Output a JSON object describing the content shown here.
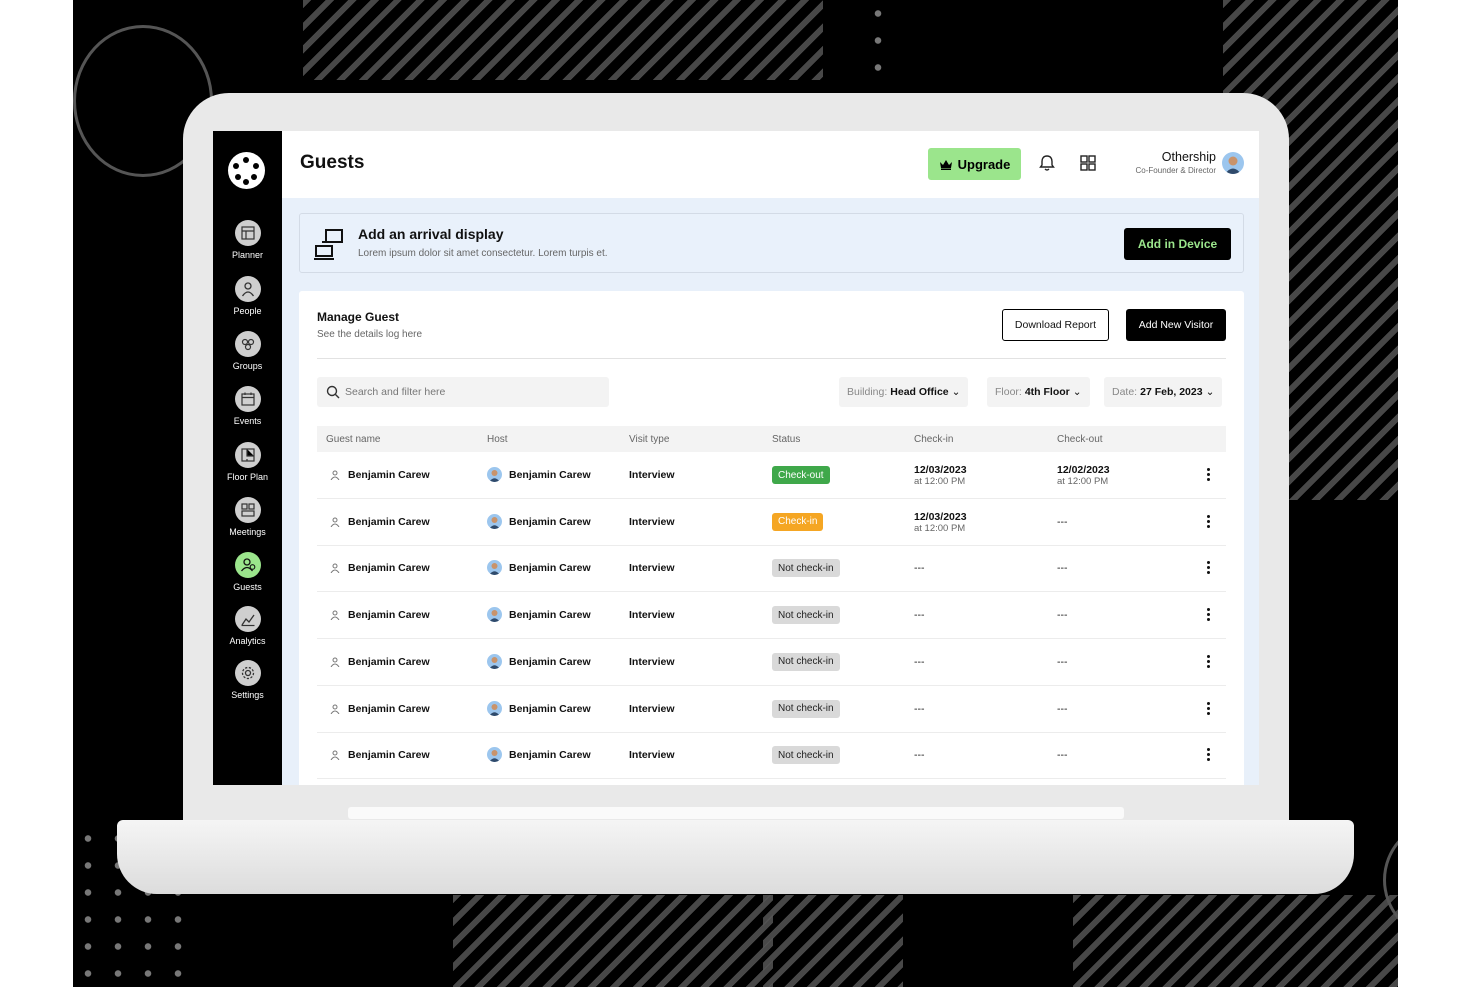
{
  "sidebar": {
    "items": [
      {
        "label": "Planner",
        "icon": "planner-icon"
      },
      {
        "label": "People",
        "icon": "person-icon"
      },
      {
        "label": "Groups",
        "icon": "groups-icon"
      },
      {
        "label": "Events",
        "icon": "calendar-icon"
      },
      {
        "label": "Floor Plan",
        "icon": "floor-plan-icon"
      },
      {
        "label": "Meetings",
        "icon": "meetings-icon"
      },
      {
        "label": "Guests",
        "icon": "guests-icon",
        "active": true
      },
      {
        "label": "Analytics",
        "icon": "analytics-icon"
      },
      {
        "label": "Settings",
        "icon": "gear-icon"
      }
    ]
  },
  "header": {
    "title": "Guests",
    "upgrade_label": "Upgrade",
    "user_name": "Othership",
    "user_role": "Co-Founder & Director"
  },
  "banner": {
    "title": "Add an arrival display",
    "subtitle": "Lorem ipsum dolor sit amet consectetur. Lorem turpis et.",
    "button": "Add in Device"
  },
  "manage": {
    "title": "Manage Guest",
    "subtitle": "See the details log here",
    "download_label": "Download Report",
    "add_label": "Add New Visitor"
  },
  "search": {
    "placeholder": "Search and filter here"
  },
  "filters": {
    "building": {
      "label": "Building:",
      "value": "Head Office"
    },
    "floor": {
      "label": "Floor:",
      "value": "4th Floor"
    },
    "date": {
      "label": "Date:",
      "value": "27 Feb, 2023"
    }
  },
  "table": {
    "columns": [
      "Guest name",
      "Host",
      "Visit type",
      "Status",
      "Check-in",
      "Check-out"
    ],
    "rows": [
      {
        "guest": "Benjamin Carew",
        "host": "Benjamin Carew",
        "type": "Interview",
        "status": "Check-out",
        "checkin_date": "12/03/2023",
        "checkin_time": "at 12:00 PM",
        "checkout_date": "12/02/2023",
        "checkout_time": "at 12:00 PM"
      },
      {
        "guest": "Benjamin Carew",
        "host": "Benjamin Carew",
        "type": "Interview",
        "status": "Check-in",
        "checkin_date": "12/03/2023",
        "checkin_time": "at 12:00 PM",
        "checkout": "---"
      },
      {
        "guest": "Benjamin Carew",
        "host": "Benjamin Carew",
        "type": "Interview",
        "status": "Not check-in",
        "checkin": "---",
        "checkout": "---"
      },
      {
        "guest": "Benjamin Carew",
        "host": "Benjamin Carew",
        "type": "Interview",
        "status": "Not check-in",
        "checkin": "---",
        "checkout": "---"
      },
      {
        "guest": "Benjamin Carew",
        "host": "Benjamin Carew",
        "type": "Interview",
        "status": "Not check-in",
        "checkin": "---",
        "checkout": "---"
      },
      {
        "guest": "Benjamin Carew",
        "host": "Benjamin Carew",
        "type": "Interview",
        "status": "Not check-in",
        "checkin": "---",
        "checkout": "---"
      },
      {
        "guest": "Benjamin Carew",
        "host": "Benjamin Carew",
        "type": "Interview",
        "status": "Not check-in",
        "checkin": "---",
        "checkout": "---"
      }
    ]
  },
  "colors": {
    "accent_green": "#9be58c",
    "status_checkout": "#3fa84a",
    "status_checkin": "#f5a623",
    "status_not": "#d9d9d9",
    "sidebar_bg": "#000000",
    "content_bg": "#e8f0fa"
  }
}
